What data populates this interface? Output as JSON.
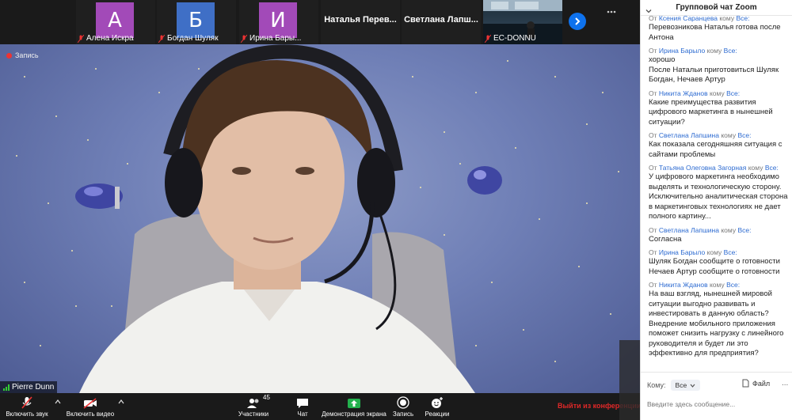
{
  "participants": [
    {
      "initial": "А",
      "name": "Алена Искра",
      "color": "#a24ab8"
    },
    {
      "initial": "Б",
      "name": "Богдан Шуляк",
      "color": "#3f6fc6"
    },
    {
      "initial": "И",
      "name": "Ирина Бары...",
      "color": "#a24ab8"
    },
    {
      "name": "Наталья Перев..."
    },
    {
      "name": "Светлана Лапш..."
    },
    {
      "name": "EC-DONNU"
    }
  ],
  "main": {
    "record_label": "Запись",
    "speaker_name": "Pierre Dunn"
  },
  "toolbar": {
    "audio": "Включить звук",
    "video": "Включить видео",
    "participants": "Участники",
    "participants_count": "45",
    "chat": "Чат",
    "share": "Демонстрация экрана",
    "record": "Запись",
    "reactions": "Реакции",
    "leave": "Выйти из конференции"
  },
  "chat": {
    "title": "Групповой чат Zoom",
    "from_word": "От",
    "to_word": "кому",
    "messages": [
      {
        "from": "Ксения Саранцева",
        "to": "Все:",
        "text": "Перевозникова Наталья готова после Антона"
      },
      {
        "from": "Ирина Барыло",
        "to": "Все:",
        "text": "хорошо\nПосле Натальи приготовиться Шуляк Богдан, Нечаев Артур"
      },
      {
        "from": "Никита Жданов",
        "to": "Все:",
        "text": "Какие преимущества развития цифрового маркетинга в нынешней ситуации?"
      },
      {
        "from": "Светлана Лапшина",
        "to": "Все:",
        "text": "Как показала сегодняшняя ситуация с сайтами проблемы"
      },
      {
        "from": "Татьяна Олеговна Загорная",
        "to": "Все:",
        "text": "У цифрового маркетинга необходимо выделять и технологическую сторону. Исключительно аналитическая сторона в маркетинговых технологиях не дает полного картину..."
      },
      {
        "from": "Светлана Лапшина",
        "to": "Все:",
        "text": "Согласна"
      },
      {
        "from": "Ирина Барыло",
        "to": "Все:",
        "text": "Шуляк Богдан сообщите о готовности\nНечаев Артур сообщите о готовности"
      },
      {
        "from": "Никита Жданов",
        "to": "Все:",
        "text": "На ваш взгляд, нынешней мировой ситуации выгодно развивать и инвестировать в данную область? Внедрение мобильного приложения поможет снизить нагрузку с линейного руководителя и будет ли это эффективно для предприятия?"
      }
    ],
    "to_label": "Кому:",
    "to_value": "Все",
    "file_label": "Файл",
    "more_label": "...",
    "input_placeholder": "Введите здесь сообщение..."
  }
}
